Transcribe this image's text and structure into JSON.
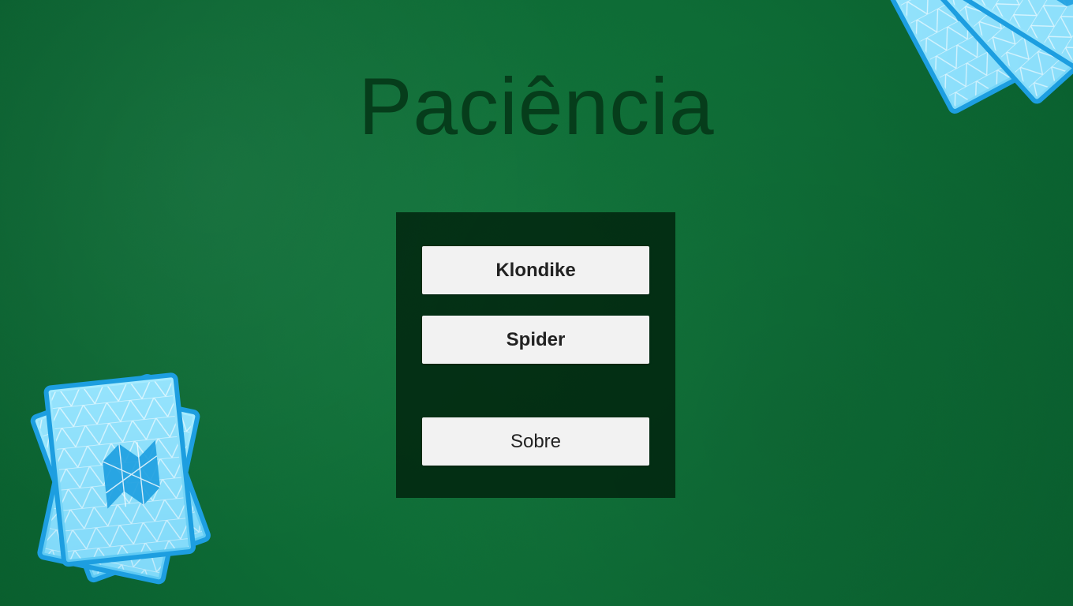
{
  "title": "Paciência",
  "menu": {
    "klondike_label": "Klondike",
    "spider_label": "Spider",
    "sobre_label": "Sobre"
  },
  "colors": {
    "felt": "#0f6a34",
    "title": "#063d1b",
    "panel": "#001e0a",
    "button": "#f2f2f2",
    "card_light": "#8fe0fb",
    "card_dark": "#1d9ee0"
  },
  "icons": {
    "bottom_left": "card-deck-icon",
    "top_right": "card-fan-icon"
  }
}
